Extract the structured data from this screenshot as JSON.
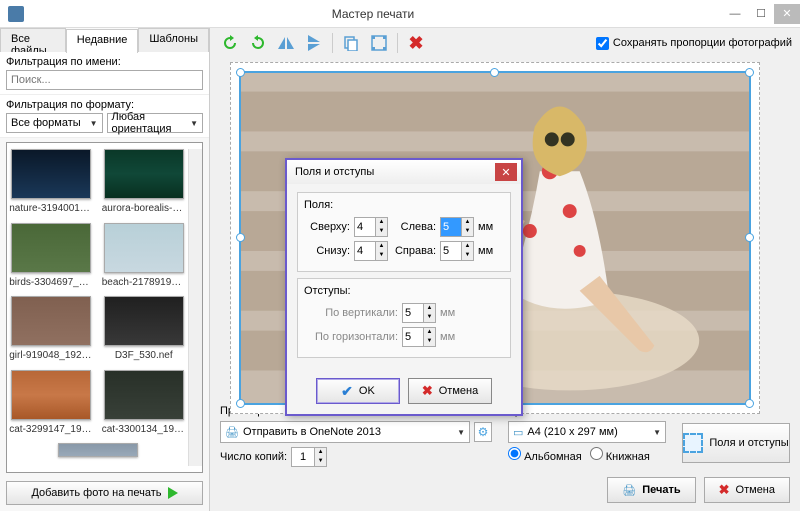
{
  "window": {
    "title": "Мастер печати"
  },
  "tabs": {
    "all_files": "Все файлы",
    "recent": "Недавние",
    "templates": "Шаблоны"
  },
  "filters": {
    "by_name_label": "Фильтрация по имени:",
    "by_name_placeholder": "Поиск...",
    "by_format_label": "Фильтрация по формату:",
    "all_formats": "Все форматы",
    "any_orientation": "Любая ориентация"
  },
  "thumbs": [
    {
      "caption": "nature-3194001_..."
    },
    {
      "caption": "aurora-borealis-1..."
    },
    {
      "caption": "birds-3304697_19..."
    },
    {
      "caption": "beach-2178919_1..."
    },
    {
      "caption": "girl-919048_1920..."
    },
    {
      "caption": "D3F_530.nef"
    },
    {
      "caption": "cat-3299147_192..."
    },
    {
      "caption": "cat-3300134_192..."
    }
  ],
  "add_button": "Добавить фото на печать",
  "keep_aspect": "Сохранять пропорции фотографий",
  "printer": {
    "label": "Принтер",
    "value": "Отправить в OneNote 2013",
    "copies_label": "Число копий:",
    "copies_value": "1"
  },
  "paper": {
    "label": "Бумага:",
    "value": "А4 (210 x 297 мм)",
    "landscape": "Альбомная",
    "portrait": "Книжная"
  },
  "margins_btn": "Поля и отступы",
  "actions": {
    "print": "Печать",
    "cancel": "Отмена"
  },
  "dialog": {
    "title": "Поля и отступы",
    "fields_group": "Поля:",
    "top_label": "Сверху:",
    "top_value": "4",
    "bottom_label": "Снизу:",
    "bottom_value": "4",
    "left_label": "Слева:",
    "left_value": "5",
    "right_label": "Справа:",
    "right_value": "5",
    "unit": "мм",
    "gaps_group": "Отступы:",
    "vert_label": "По вертикали:",
    "vert_value": "5",
    "horiz_label": "По горизонтали:",
    "horiz_value": "5",
    "ok": "OK",
    "cancel": "Отмена"
  }
}
